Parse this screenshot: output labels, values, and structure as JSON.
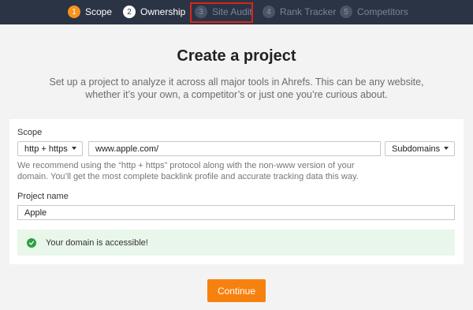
{
  "stepper": {
    "steps": [
      {
        "number": "1",
        "label": "Scope",
        "state": "active"
      },
      {
        "number": "2",
        "label": "Ownership",
        "state": "done"
      },
      {
        "number": "3",
        "label": "Site Audit",
        "state": "inactive"
      },
      {
        "number": "4",
        "label": "Rank Tracker",
        "state": "inactive"
      },
      {
        "number": "5",
        "label": "Competitors",
        "state": "inactive"
      }
    ],
    "highlight_color": "#d9241c"
  },
  "header": {
    "title": "Create a project",
    "subtitle": "Set up a project to analyze it across all major tools in Ahrefs. This can be any website, whether it’s your own, a competitor’s or just one you’re curious about."
  },
  "form": {
    "scope_label": "Scope",
    "protocol_value": "http + https",
    "domain_value": "www.apple.com/",
    "mode_value": "Subdomains",
    "hint": "We recommend using the “http + https” protocol along with the non-www version of your domain. You’ll get the most complete backlink profile and accurate tracking data this way.",
    "project_name_label": "Project name",
    "project_name_value": "Apple",
    "success_message": "Your domain is accessible!"
  },
  "actions": {
    "continue_label": "Continue"
  },
  "colors": {
    "accent": "#f7810f",
    "topbar": "#2b3444",
    "success_bg": "#e9f6ea",
    "success_icon": "#2ea043"
  }
}
